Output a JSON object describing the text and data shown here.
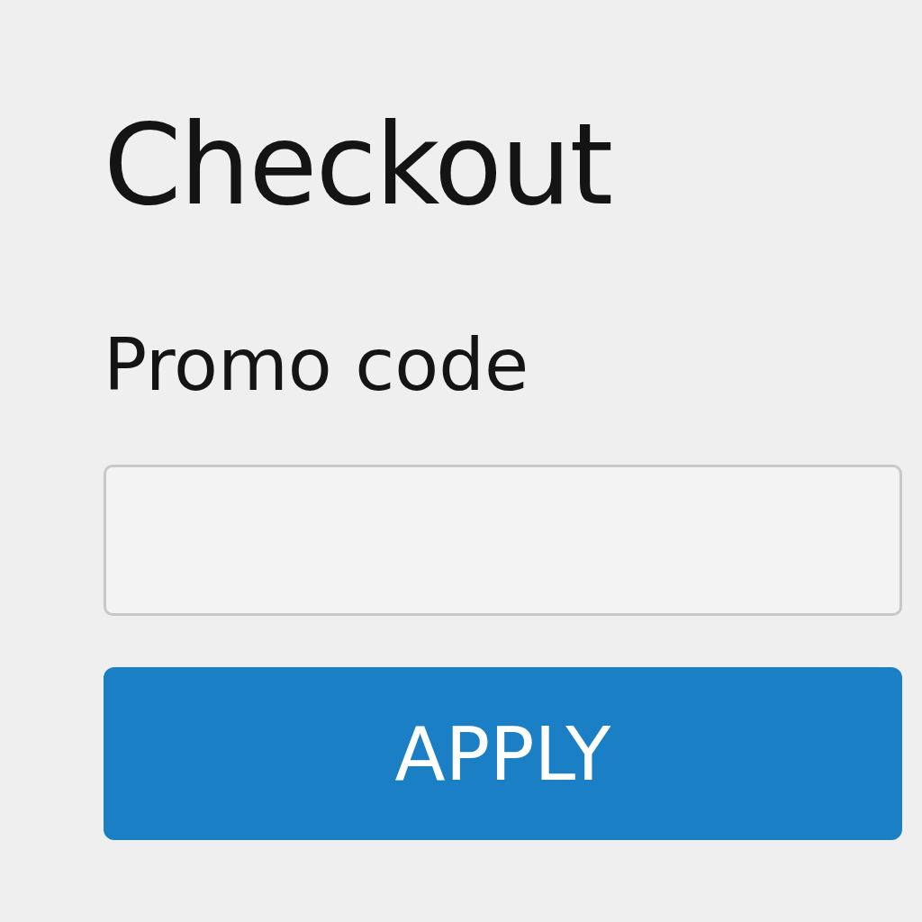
{
  "title": "Checkout",
  "promo": {
    "label": "Promo code"
  },
  "button": {
    "label": "APPLY"
  }
}
